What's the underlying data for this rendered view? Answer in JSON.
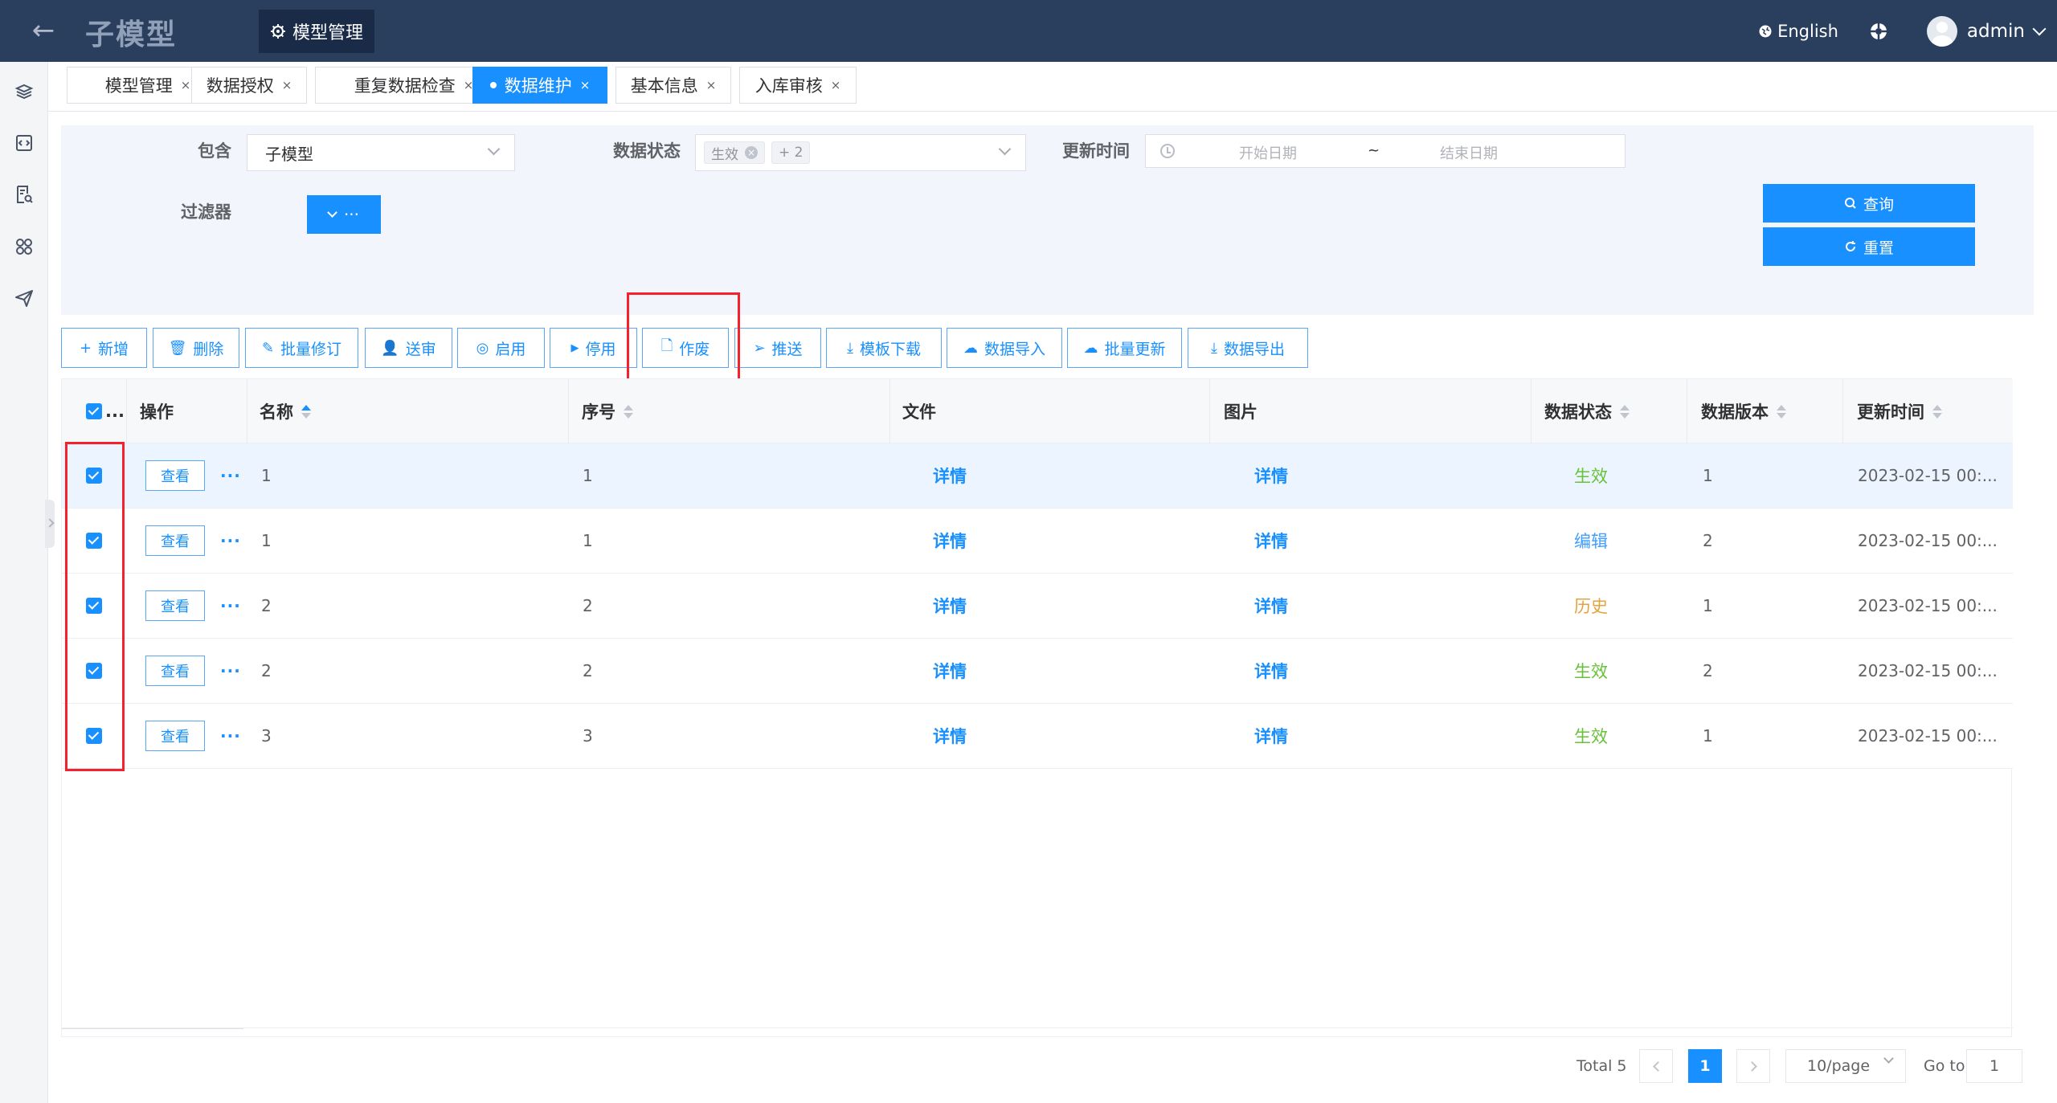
{
  "header": {
    "back_icon": "arrow-left-icon",
    "app_title": "子模型",
    "top_tab": "模型管理",
    "language": "English",
    "user": "admin",
    "bg_color": "#2a3e5e"
  },
  "sidebar": {
    "icons": [
      "layers-icon",
      "code-window-icon",
      "document-search-icon",
      "apps-grid-icon",
      "send-icon"
    ]
  },
  "tabs": [
    {
      "label": "模型管理",
      "active": false
    },
    {
      "label": "数据授权",
      "active": false
    },
    {
      "label": "重复数据检查",
      "active": false
    },
    {
      "label": "数据维护",
      "active": true
    },
    {
      "label": "基本信息",
      "active": false
    },
    {
      "label": "入库审核",
      "active": false
    }
  ],
  "tab_close": "×",
  "filter": {
    "contains_label": "包含",
    "contains_value": "子模型",
    "status_label": "数据状态",
    "status_tag": "生效",
    "status_more": "+ 2",
    "update_label": "更新时间",
    "start_placeholder": "开始日期",
    "range_sep": "~",
    "end_placeholder": "结束日期",
    "filter_label": "过滤器",
    "filter_btn": "···",
    "query_btn": "查询",
    "reset_btn": "重置"
  },
  "toolbar": {
    "add": "新增",
    "delete": "删除",
    "batch_edit": "批量修订",
    "submit": "送审",
    "enable": "启用",
    "disable": "停用",
    "void": "作废",
    "push": "推送",
    "template_download": "模板下载",
    "data_import": "数据导入",
    "batch_update": "批量更新",
    "data_export": "数据导出"
  },
  "table": {
    "headers": {
      "select": "...",
      "ops": "操作",
      "name": "名称",
      "seq": "序号",
      "file": "文件",
      "image": "图片",
      "status": "数据状态",
      "version": "数据版本",
      "updated": "更新时间"
    },
    "view_label": "查看",
    "more_label": "···",
    "rows": [
      {
        "name": "1",
        "seq": "1",
        "file": "详情",
        "image": "详情",
        "status": "生效",
        "status_color": "#67c23a",
        "version": "1",
        "updated": "2023-02-15 00:...",
        "highlight": true
      },
      {
        "name": "1",
        "seq": "1",
        "file": "详情",
        "image": "详情",
        "status": "编辑",
        "status_color": "#409eff",
        "version": "2",
        "updated": "2023-02-15 00:...",
        "highlight": false
      },
      {
        "name": "2",
        "seq": "2",
        "file": "详情",
        "image": "详情",
        "status": "历史",
        "status_color": "#e6a23c",
        "version": "1",
        "updated": "2023-02-15 00:...",
        "highlight": false
      },
      {
        "name": "2",
        "seq": "2",
        "file": "详情",
        "image": "详情",
        "status": "生效",
        "status_color": "#67c23a",
        "version": "2",
        "updated": "2023-02-15 00:...",
        "highlight": false
      },
      {
        "name": "3",
        "seq": "3",
        "file": "详情",
        "image": "详情",
        "status": "生效",
        "status_color": "#67c23a",
        "version": "1",
        "updated": "2023-02-15 00:...",
        "highlight": false
      }
    ]
  },
  "pagination": {
    "total": "Total 5",
    "current": "1",
    "page_size": "10/page",
    "goto_label": "Go to",
    "goto_value": "1"
  },
  "colors": {
    "primary": "#1890ff",
    "annotation_red": "#f5222d",
    "filter_bg": "#f2f5fb"
  }
}
